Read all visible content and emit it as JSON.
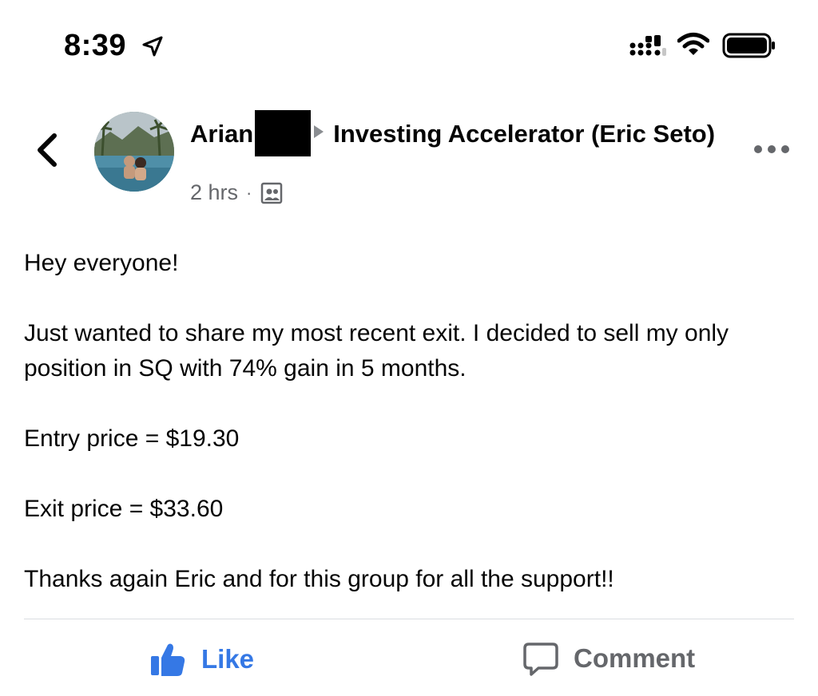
{
  "status_bar": {
    "time": "8:39",
    "icons": [
      "location-arrow-icon",
      "cellular-signal-icon",
      "wifi-icon",
      "battery-icon"
    ]
  },
  "post": {
    "author": "Arian",
    "group": "Investing Accelerator (Eric Seto)",
    "time_ago": "2 hrs",
    "meta_separator": "·",
    "body": [
      "Hey everyone!",
      "Just wanted to share my most recent exit. I decided to sell my only position in SQ with 74% gain in 5 months.",
      "Entry price = $19.30",
      "Exit price = $33.60",
      "Thanks again Eric and for this group for all the support!!"
    ]
  },
  "actions": {
    "like_label": "Like",
    "comment_label": "Comment"
  },
  "colors": {
    "like_blue": "#3578e5",
    "secondary_text": "#65676b",
    "primary_text": "#050505",
    "divider": "#dadde1"
  }
}
